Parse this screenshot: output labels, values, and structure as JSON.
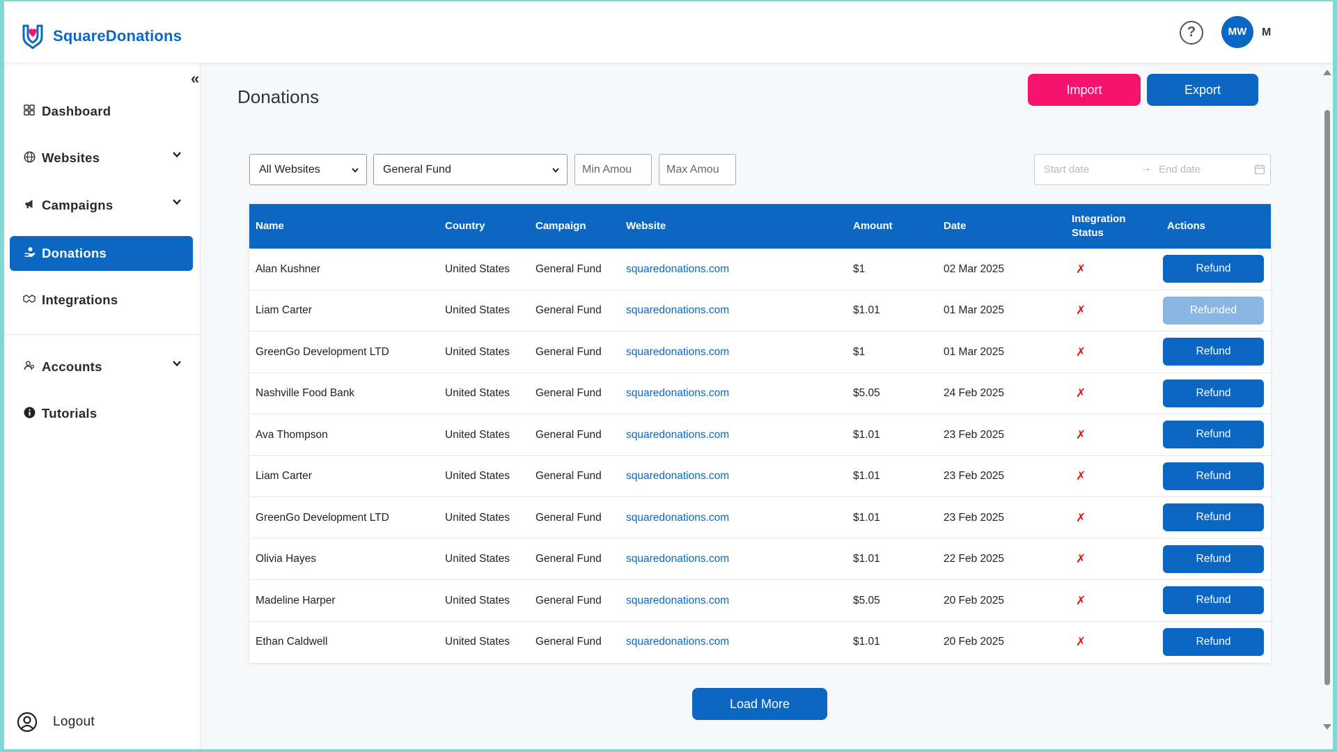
{
  "brand": {
    "name": "SquareDonations",
    "accent": "#0b67c2",
    "import_color": "#f5136e"
  },
  "header": {
    "help_icon": "?",
    "avatar_initials": "MW",
    "user_label": "M"
  },
  "sidebar": {
    "collapse_icon": "«",
    "items": [
      {
        "label": "Dashboard",
        "icon": "grid-icon"
      },
      {
        "label": "Websites",
        "icon": "globe-icon"
      },
      {
        "label": "Campaigns",
        "icon": "megaphone-icon"
      },
      {
        "label": "Donations",
        "icon": "donate-icon"
      },
      {
        "label": "Integrations",
        "icon": "plug-icon"
      },
      {
        "label": "Accounts",
        "icon": "users-icon"
      },
      {
        "label": "Tutorials",
        "icon": "info-icon"
      }
    ],
    "logout_label": "Logout"
  },
  "page": {
    "title": "Donations",
    "import_label": "Import",
    "export_label": "Export",
    "load_more_label": "Load More"
  },
  "filters": {
    "website_selected": "All Websites",
    "campaign_selected": "General Fund",
    "min_placeholder": "Min Amou",
    "max_placeholder": "Max Amou",
    "start_date_placeholder": "Start date",
    "end_date_placeholder": "End date"
  },
  "table": {
    "headers": {
      "name": "Name",
      "country": "Country",
      "campaign": "Campaign",
      "website": "Website",
      "amount": "Amount",
      "date": "Date",
      "status_line1": "Integration",
      "status_line2": "Status",
      "actions": "Actions"
    },
    "rows": [
      {
        "name": "Alan Kushner",
        "country": "United States",
        "campaign": "General Fund",
        "website": "squaredonations.com",
        "amount": "$1",
        "date": "02 Mar 2025",
        "status": "✗",
        "action": "Refund"
      },
      {
        "name": "Liam Carter",
        "country": "United States",
        "campaign": "General Fund",
        "website": "squaredonations.com",
        "amount": "$1.01",
        "date": "01 Mar 2025",
        "status": "✗",
        "action": "Refunded"
      },
      {
        "name": "GreenGo Development LTD",
        "country": "United States",
        "campaign": "General Fund",
        "website": "squaredonations.com",
        "amount": "$1",
        "date": "01 Mar 2025",
        "status": "✗",
        "action": "Refund"
      },
      {
        "name": "Nashville Food Bank",
        "country": "United States",
        "campaign": "General Fund",
        "website": "squaredonations.com",
        "amount": "$5.05",
        "date": "24 Feb 2025",
        "status": "✗",
        "action": "Refund"
      },
      {
        "name": "Ava Thompson",
        "country": "United States",
        "campaign": "General Fund",
        "website": "squaredonations.com",
        "amount": "$1.01",
        "date": "23 Feb 2025",
        "status": "✗",
        "action": "Refund"
      },
      {
        "name": "Liam Carter",
        "country": "United States",
        "campaign": "General Fund",
        "website": "squaredonations.com",
        "amount": "$1.01",
        "date": "23 Feb 2025",
        "status": "✗",
        "action": "Refund"
      },
      {
        "name": "GreenGo Development LTD",
        "country": "United States",
        "campaign": "General Fund",
        "website": "squaredonations.com",
        "amount": "$1.01",
        "date": "23 Feb 2025",
        "status": "✗",
        "action": "Refund"
      },
      {
        "name": "Olivia Hayes",
        "country": "United States",
        "campaign": "General Fund",
        "website": "squaredonations.com",
        "amount": "$1.01",
        "date": "22 Feb 2025",
        "status": "✗",
        "action": "Refund"
      },
      {
        "name": "Madeline Harper",
        "country": "United States",
        "campaign": "General Fund",
        "website": "squaredonations.com",
        "amount": "$5.05",
        "date": "20 Feb 2025",
        "status": "✗",
        "action": "Refund"
      },
      {
        "name": "Ethan Caldwell",
        "country": "United States",
        "campaign": "General Fund",
        "website": "squaredonations.com",
        "amount": "$1.01",
        "date": "20 Feb 2025",
        "status": "✗",
        "action": "Refund"
      }
    ]
  }
}
